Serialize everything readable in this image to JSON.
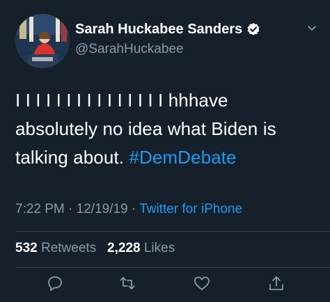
{
  "user": {
    "display_name": "Sarah Huckabee Sanders",
    "handle": "@SarahHuckabee",
    "verified": true
  },
  "tweet": {
    "text_lines": [
      "I I I I I I I I I I I I I I I hhhave",
      "absolutely no idea what Biden is",
      "talking about."
    ],
    "hashtag": "#DemDebate"
  },
  "meta": {
    "time": "7:22 PM",
    "sep1": "·",
    "date": "12/19/19",
    "sep2": "·",
    "source": "Twitter for iPhone"
  },
  "stats": {
    "retweets_count": "532",
    "retweets_label": "Retweets",
    "likes_count": "2,228",
    "likes_label": "Likes"
  },
  "colors": {
    "background": "#15202b",
    "accent": "#1d9bf0",
    "secondary_text": "#8899a6",
    "divider": "#38444d"
  },
  "icons": [
    "reply-icon",
    "retweet-icon",
    "like-icon",
    "share-icon",
    "verified-icon",
    "chevron-down-icon"
  ]
}
